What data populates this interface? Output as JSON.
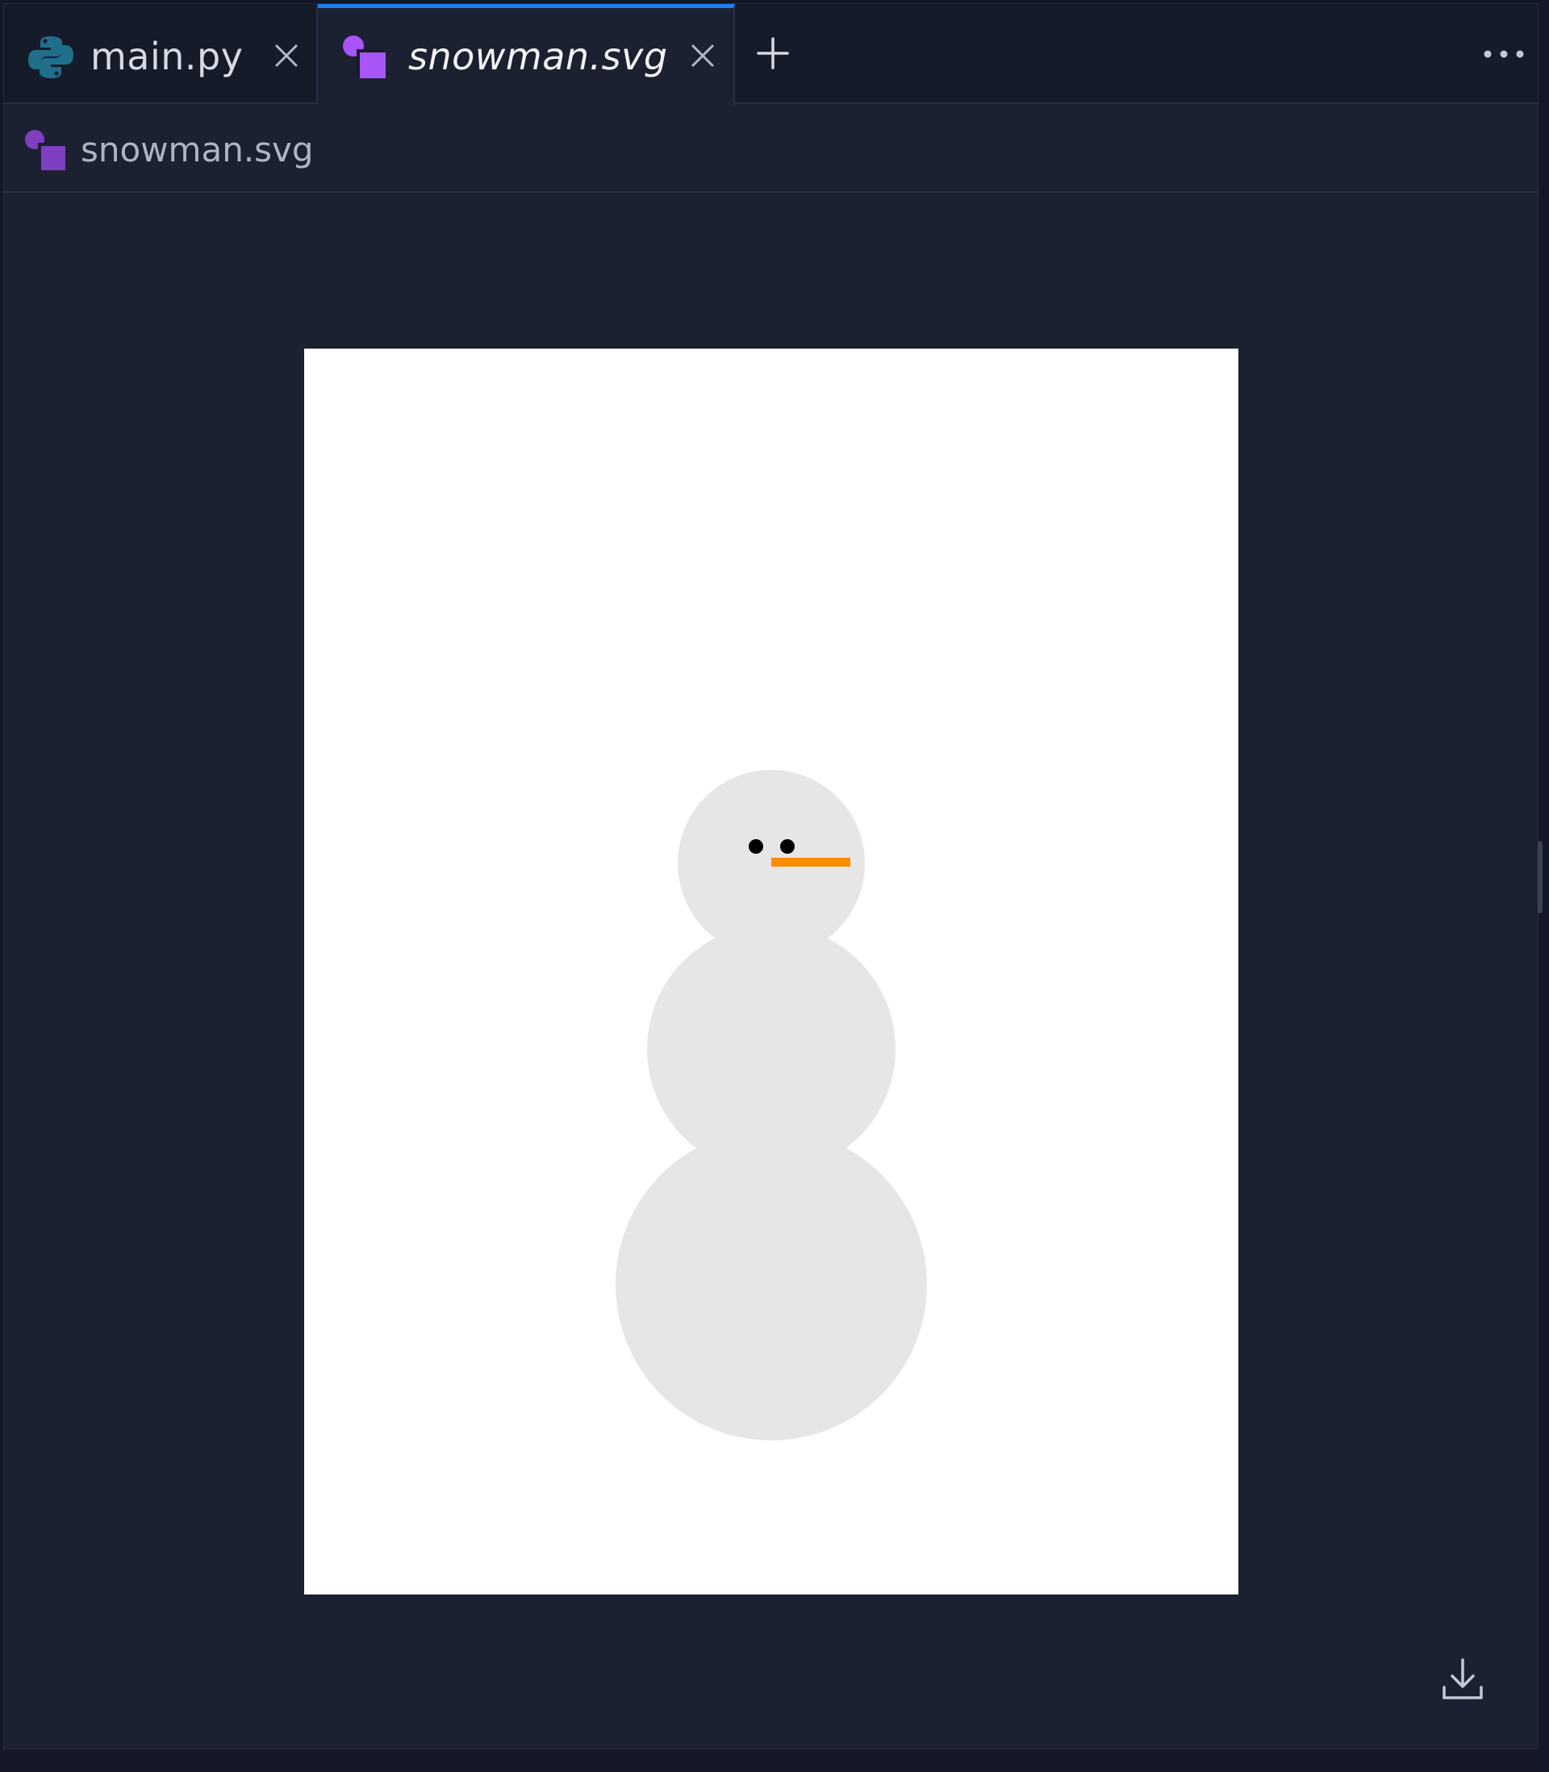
{
  "tabs": [
    {
      "label": "main.py",
      "icon": "python-file-icon",
      "active": false
    },
    {
      "label": "snowman.svg",
      "icon": "svg-file-icon",
      "active": true
    }
  ],
  "breadcrumb": {
    "label": "snowman.svg",
    "icon": "svg-file-icon"
  },
  "colors": {
    "accent": "#1f7ff0",
    "python_icon": "#1f6f8b",
    "svg_icon": "#a855f7",
    "snow": "#e6e6e6",
    "eyes": "#000000",
    "nose": "#ff8c00"
  },
  "icons": {
    "new_tab": "plus-icon",
    "more": "more-horizontal-icon",
    "download": "download-icon",
    "close": "close-icon"
  }
}
